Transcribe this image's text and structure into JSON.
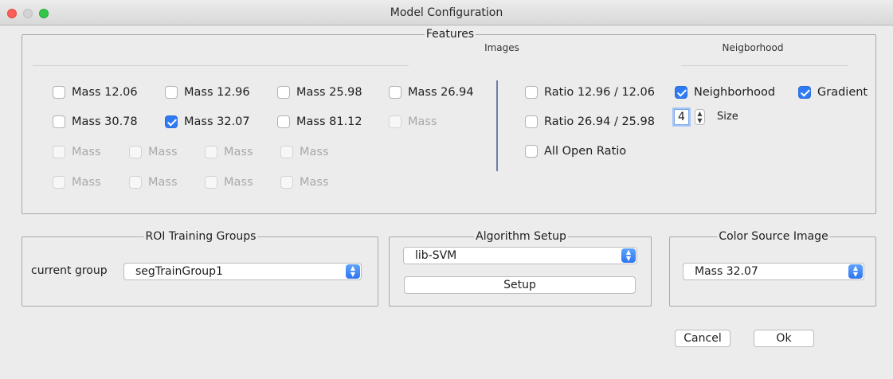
{
  "window": {
    "title": "Model Configuration"
  },
  "features": {
    "legend": "Features",
    "images_heading": "Images",
    "neighborhood_heading": "Neigborhood",
    "mass_checkboxes": [
      {
        "label": "Mass 12.06",
        "checked": false,
        "enabled": true
      },
      {
        "label": "Mass 12.96",
        "checked": false,
        "enabled": true
      },
      {
        "label": "Mass 25.98",
        "checked": false,
        "enabled": true
      },
      {
        "label": "Mass 26.94",
        "checked": false,
        "enabled": true
      },
      {
        "label": "Mass 30.78",
        "checked": false,
        "enabled": true
      },
      {
        "label": "Mass 32.07",
        "checked": true,
        "enabled": true
      },
      {
        "label": "Mass 81.12",
        "checked": false,
        "enabled": true
      },
      {
        "label": "Mass",
        "checked": false,
        "enabled": false
      },
      {
        "label": "Mass",
        "checked": false,
        "enabled": false
      },
      {
        "label": "Mass",
        "checked": false,
        "enabled": false
      },
      {
        "label": "Mass",
        "checked": false,
        "enabled": false
      },
      {
        "label": "Mass",
        "checked": false,
        "enabled": false
      },
      {
        "label": "Mass",
        "checked": false,
        "enabled": false
      },
      {
        "label": "Mass",
        "checked": false,
        "enabled": false
      },
      {
        "label": "Mass",
        "checked": false,
        "enabled": false
      },
      {
        "label": "Mass",
        "checked": false,
        "enabled": false
      }
    ],
    "ratio_checkboxes": [
      {
        "label": "Ratio 12.96 / 12.06",
        "checked": false
      },
      {
        "label": "Ratio 26.94 / 25.98",
        "checked": false
      },
      {
        "label": "All Open Ratio",
        "checked": false
      }
    ],
    "neighborhood_checkbox": {
      "label": "Neighborhood",
      "checked": true
    },
    "gradient_checkbox": {
      "label": "Gradient",
      "checked": true
    },
    "size_spinner": {
      "value": "4",
      "label": "Size"
    }
  },
  "roi": {
    "legend": "ROI Training Groups",
    "current_group_label": "current group",
    "current_group_value": "segTrainGroup1"
  },
  "algorithm": {
    "legend": "Algorithm Setup",
    "selected": "lib-SVM",
    "setup_button": "Setup"
  },
  "color_source": {
    "legend": "Color Source Image",
    "selected": "Mass 32.07"
  },
  "buttons": {
    "cancel": "Cancel",
    "ok": "Ok"
  },
  "icons": {
    "combo_arrow": "up-down-chevron-icon",
    "spinner_arrow": "up-down-chevron-icon",
    "checkmark": "checkmark-icon"
  },
  "colors": {
    "accent": "#2f7af5",
    "separator": "#6d7fa8"
  }
}
